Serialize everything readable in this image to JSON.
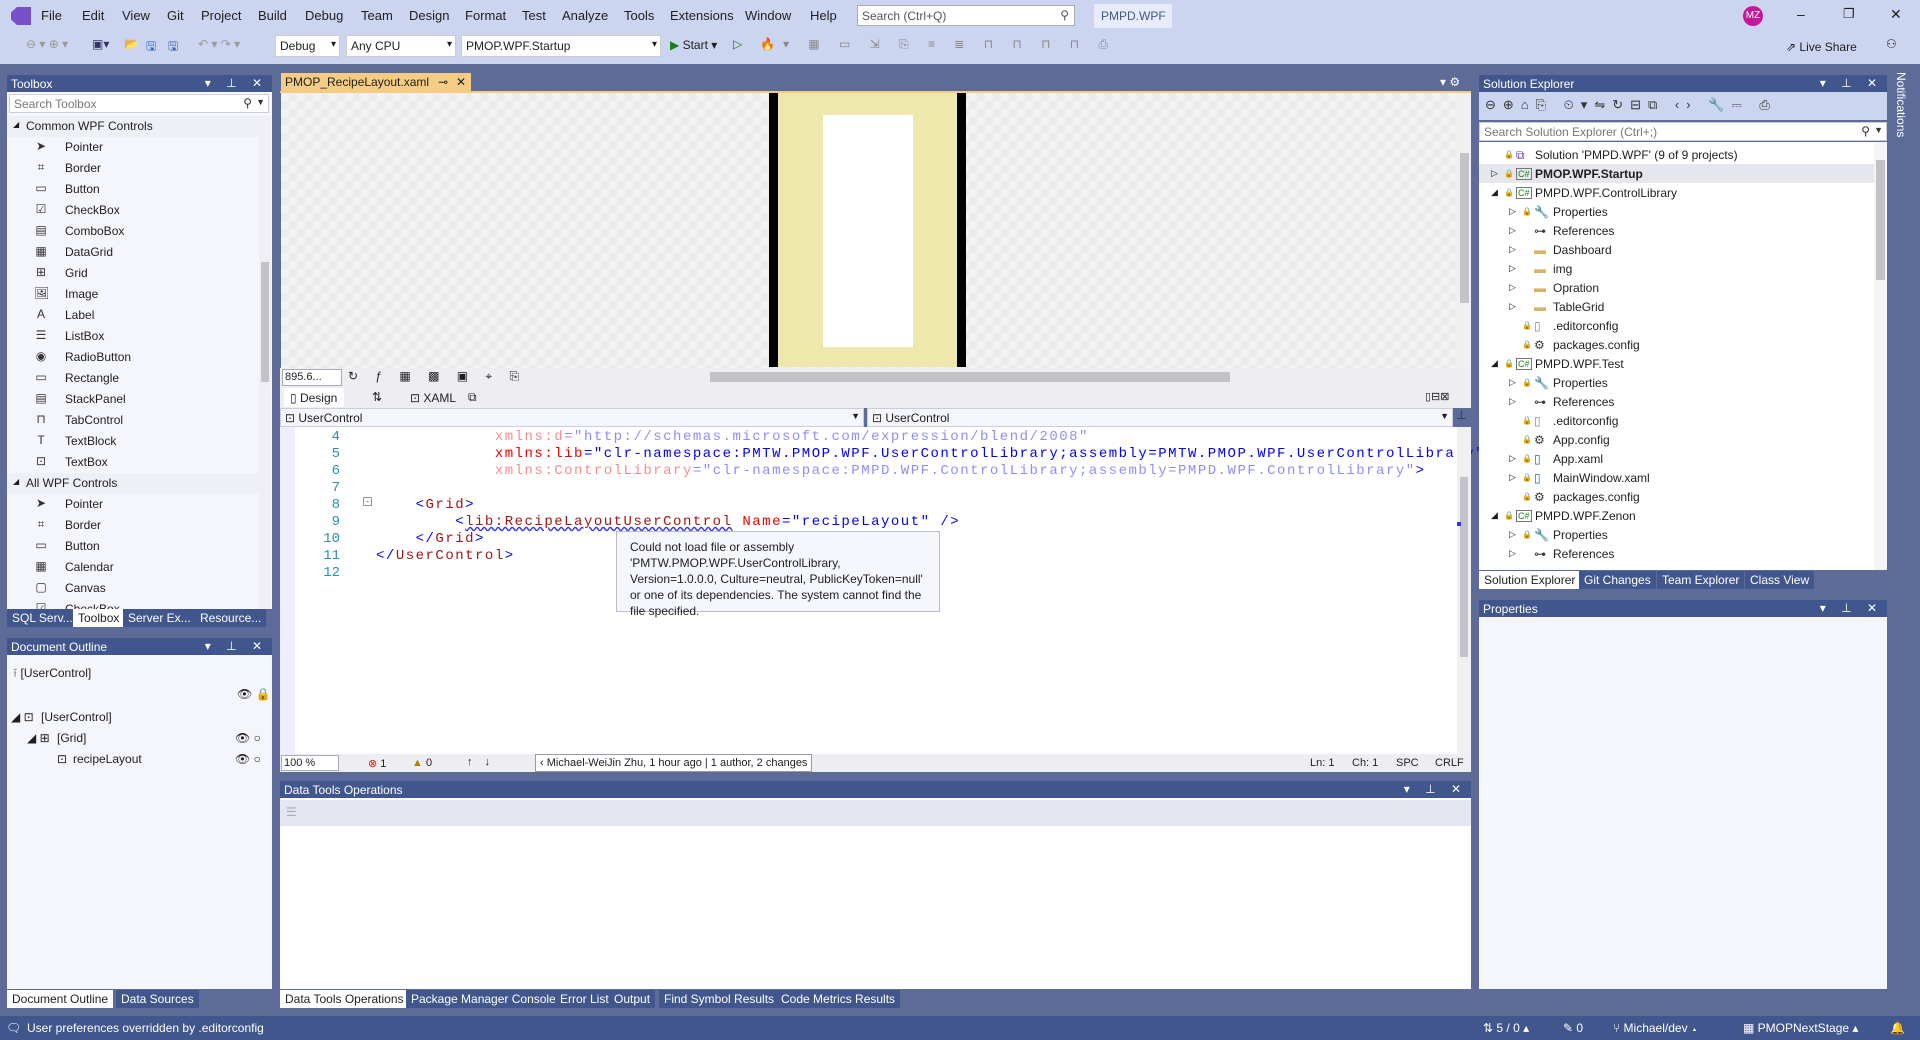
{
  "menu": [
    "File",
    "Edit",
    "View",
    "Git",
    "Project",
    "Build",
    "Debug",
    "Team",
    "Design",
    "Format",
    "Test",
    "Analyze",
    "Tools",
    "Extensions",
    "Window",
    "Help"
  ],
  "search_placeholder": "Search (Ctrl+Q)",
  "solution_badge": "PMPD.WPF",
  "user_initials": "MZ",
  "toolbar": {
    "config": "Debug",
    "platform": "Any CPU",
    "startup": "PMOP.WPF.Startup",
    "start": "Start",
    "live_share": "Live Share"
  },
  "toolbox": {
    "title": "Toolbox",
    "search_placeholder": "Search Toolbox",
    "common_header": "Common WPF Controls",
    "common": [
      {
        "icon": "pointer",
        "label": "Pointer"
      },
      {
        "icon": "border",
        "label": "Border"
      },
      {
        "icon": "button",
        "label": "Button"
      },
      {
        "icon": "checkbox",
        "label": "CheckBox"
      },
      {
        "icon": "combobox",
        "label": "ComboBox"
      },
      {
        "icon": "datagrid",
        "label": "DataGrid"
      },
      {
        "icon": "grid",
        "label": "Grid"
      },
      {
        "icon": "image",
        "label": "Image"
      },
      {
        "icon": "label",
        "label": "Label"
      },
      {
        "icon": "listbox",
        "label": "ListBox"
      },
      {
        "icon": "radiobutton",
        "label": "RadioButton"
      },
      {
        "icon": "rectangle",
        "label": "Rectangle"
      },
      {
        "icon": "stackpanel",
        "label": "StackPanel"
      },
      {
        "icon": "tabcontrol",
        "label": "TabControl"
      },
      {
        "icon": "textblock",
        "label": "TextBlock"
      },
      {
        "icon": "textbox",
        "label": "TextBox"
      }
    ],
    "all_header": "All WPF Controls",
    "all": [
      {
        "icon": "pointer",
        "label": "Pointer"
      },
      {
        "icon": "border",
        "label": "Border"
      },
      {
        "icon": "button",
        "label": "Button"
      },
      {
        "icon": "calendar",
        "label": "Calendar"
      },
      {
        "icon": "canvas",
        "label": "Canvas"
      },
      {
        "icon": "checkbox",
        "label": "CheckBox"
      }
    ],
    "tabs": [
      "SQL Serv...",
      "Toolbox",
      "Server Ex...",
      "Resource..."
    ]
  },
  "outline": {
    "title": "Document Outline",
    "root": "[UserControl]",
    "tree": [
      {
        "label": "[UserControl]"
      },
      {
        "label": "[Grid]"
      },
      {
        "label": "recipeLayout"
      }
    ],
    "tabs": [
      "Document Outline",
      "Data Sources"
    ]
  },
  "editor": {
    "tab": "PMOP_RecipeLayout.xaml",
    "zoom_design": "895.6...",
    "design_tab": "Design",
    "xaml_tab": "XAML",
    "left_dropdown": "UserControl",
    "right_dropdown": "UserControl",
    "lines": [
      {
        "n": "4",
        "parts": [
          {
            "t": "            "
          },
          {
            "t": "xmlns:d",
            "c": "red fade"
          },
          {
            "t": "=",
            "c": "blue fade"
          },
          {
            "t": "\"http://schemas.microsoft.com/expression/blend/2008\"",
            "c": "blue fade"
          }
        ]
      },
      {
        "n": "5",
        "parts": [
          {
            "t": "            "
          },
          {
            "t": "xmlns:lib",
            "c": "red"
          },
          {
            "t": "=",
            "c": "blue"
          },
          {
            "t": "\"clr-namespace:PMTW.PMOP.WPF.UserControlLibrary;assembly=PMTW.PMOP.WPF.UserControlLibrary\"",
            "c": "blue"
          }
        ]
      },
      {
        "n": "6",
        "parts": [
          {
            "t": "            "
          },
          {
            "t": "xmlns:ControlLibrary",
            "c": "red fade"
          },
          {
            "t": "=",
            "c": "blue fade"
          },
          {
            "t": "\"clr-namespace:PMPD.WPF.ControlLibrary;assembly=PMPD.WPF.ControlLibrary\"",
            "c": "blue fade"
          },
          {
            "t": ">",
            "c": "blue"
          }
        ]
      },
      {
        "n": "7",
        "parts": []
      },
      {
        "n": "8",
        "parts": [
          {
            "t": "    "
          },
          {
            "t": "<",
            "c": "blue"
          },
          {
            "t": "Grid",
            "c": "brown"
          },
          {
            "t": ">",
            "c": "blue"
          }
        ]
      },
      {
        "n": "9",
        "parts": [
          {
            "t": "        "
          },
          {
            "t": "<",
            "c": "blue"
          },
          {
            "t": "lib:RecipeLayoutUserControl",
            "c": "brown"
          },
          {
            "t": " "
          },
          {
            "t": "Name",
            "c": "red"
          },
          {
            "t": "=\"recipeLayout\" />",
            "c": "blue"
          }
        ]
      },
      {
        "n": "10",
        "parts": [
          {
            "t": "    "
          },
          {
            "t": "</",
            "c": "blue"
          },
          {
            "t": "Grid",
            "c": "brown"
          },
          {
            "t": ">",
            "c": "blue"
          }
        ]
      },
      {
        "n": "11",
        "parts": [
          {
            "t": "</",
            "c": "blue"
          },
          {
            "t": "UserControl",
            "c": "brown"
          },
          {
            "t": ">",
            "c": "blue"
          }
        ]
      },
      {
        "n": "12",
        "parts": []
      }
    ],
    "tooltip": "Could not load file or assembly 'PMTW.PMOP.WPF.UserControlLibrary, Version=1.0.0.0, Culture=neutral, PublicKeyToken=null' or one of its dependencies. The system cannot find the file specified.",
    "status": {
      "zoom": "100 %",
      "errors": "1",
      "warnings": "0",
      "blame": "Michael-WeiJin Zhu, 1 hour ago | 1 author, 2 changes",
      "ln": "Ln: 1",
      "ch": "Ch: 1",
      "spc": "SPC",
      "crlf": "CRLF"
    }
  },
  "data_tools": {
    "title": "Data Tools Operations",
    "tabs": [
      "Data Tools Operations",
      "Package Manager Console",
      "Error List",
      "Output",
      "Find Symbol Results",
      "Code Metrics Results"
    ]
  },
  "solution_explorer": {
    "title": "Solution Explorer",
    "search_placeholder": "Search Solution Explorer (Ctrl+;)",
    "rows": [
      {
        "d": 0,
        "exp": "",
        "icon": "solution",
        "label": "Solution 'PMPD.WPF' (9 of 9 projects)"
      },
      {
        "d": 0,
        "exp": "▷",
        "icon": "csharp",
        "label": "PMOP.WPF.Startup",
        "bold": true
      },
      {
        "d": 0,
        "exp": "◢",
        "icon": "csharp",
        "label": "PMPD.WPF.ControlLibrary"
      },
      {
        "d": 1,
        "exp": "▷",
        "icon": "wrench",
        "label": "Properties"
      },
      {
        "d": 1,
        "exp": "▷",
        "icon": "references",
        "label": "References"
      },
      {
        "d": 1,
        "exp": "▷",
        "icon": "folder",
        "label": "Dashboard"
      },
      {
        "d": 1,
        "exp": "▷",
        "icon": "folder",
        "label": "img"
      },
      {
        "d": 1,
        "exp": "▷",
        "icon": "folder",
        "label": "Opration"
      },
      {
        "d": 1,
        "exp": "▷",
        "icon": "folder",
        "label": "TableGrid"
      },
      {
        "d": 1,
        "exp": "",
        "icon": "file",
        "label": ".editorconfig"
      },
      {
        "d": 1,
        "exp": "",
        "icon": "config",
        "label": "packages.config"
      },
      {
        "d": 0,
        "exp": "◢",
        "icon": "csharp",
        "label": "PMPD.WPF.Test"
      },
      {
        "d": 1,
        "exp": "▷",
        "icon": "wrench",
        "label": "Properties"
      },
      {
        "d": 1,
        "exp": "▷",
        "icon": "references",
        "label": "References"
      },
      {
        "d": 1,
        "exp": "",
        "icon": "file",
        "label": ".editorconfig"
      },
      {
        "d": 1,
        "exp": "",
        "icon": "config",
        "label": "App.config"
      },
      {
        "d": 1,
        "exp": "▷",
        "icon": "xaml",
        "label": "App.xaml"
      },
      {
        "d": 1,
        "exp": "▷",
        "icon": "xaml",
        "label": "MainWindow.xaml"
      },
      {
        "d": 1,
        "exp": "",
        "icon": "config",
        "label": "packages.config"
      },
      {
        "d": 0,
        "exp": "◢",
        "icon": "csharp",
        "label": "PMPD.WPF.Zenon"
      },
      {
        "d": 1,
        "exp": "▷",
        "icon": "wrench",
        "label": "Properties"
      },
      {
        "d": 1,
        "exp": "▷",
        "icon": "references",
        "label": "References"
      }
    ],
    "tabs": [
      "Solution Explorer",
      "Git Changes",
      "Team Explorer",
      "Class View"
    ]
  },
  "properties": {
    "title": "Properties"
  },
  "notifications": "Notifications",
  "statusbar": {
    "message": "User preferences overridden by .editorconfig",
    "sync": "5 / 0",
    "edits": "0",
    "branch": "Michael/dev",
    "repo": "PMOPNextStage"
  }
}
